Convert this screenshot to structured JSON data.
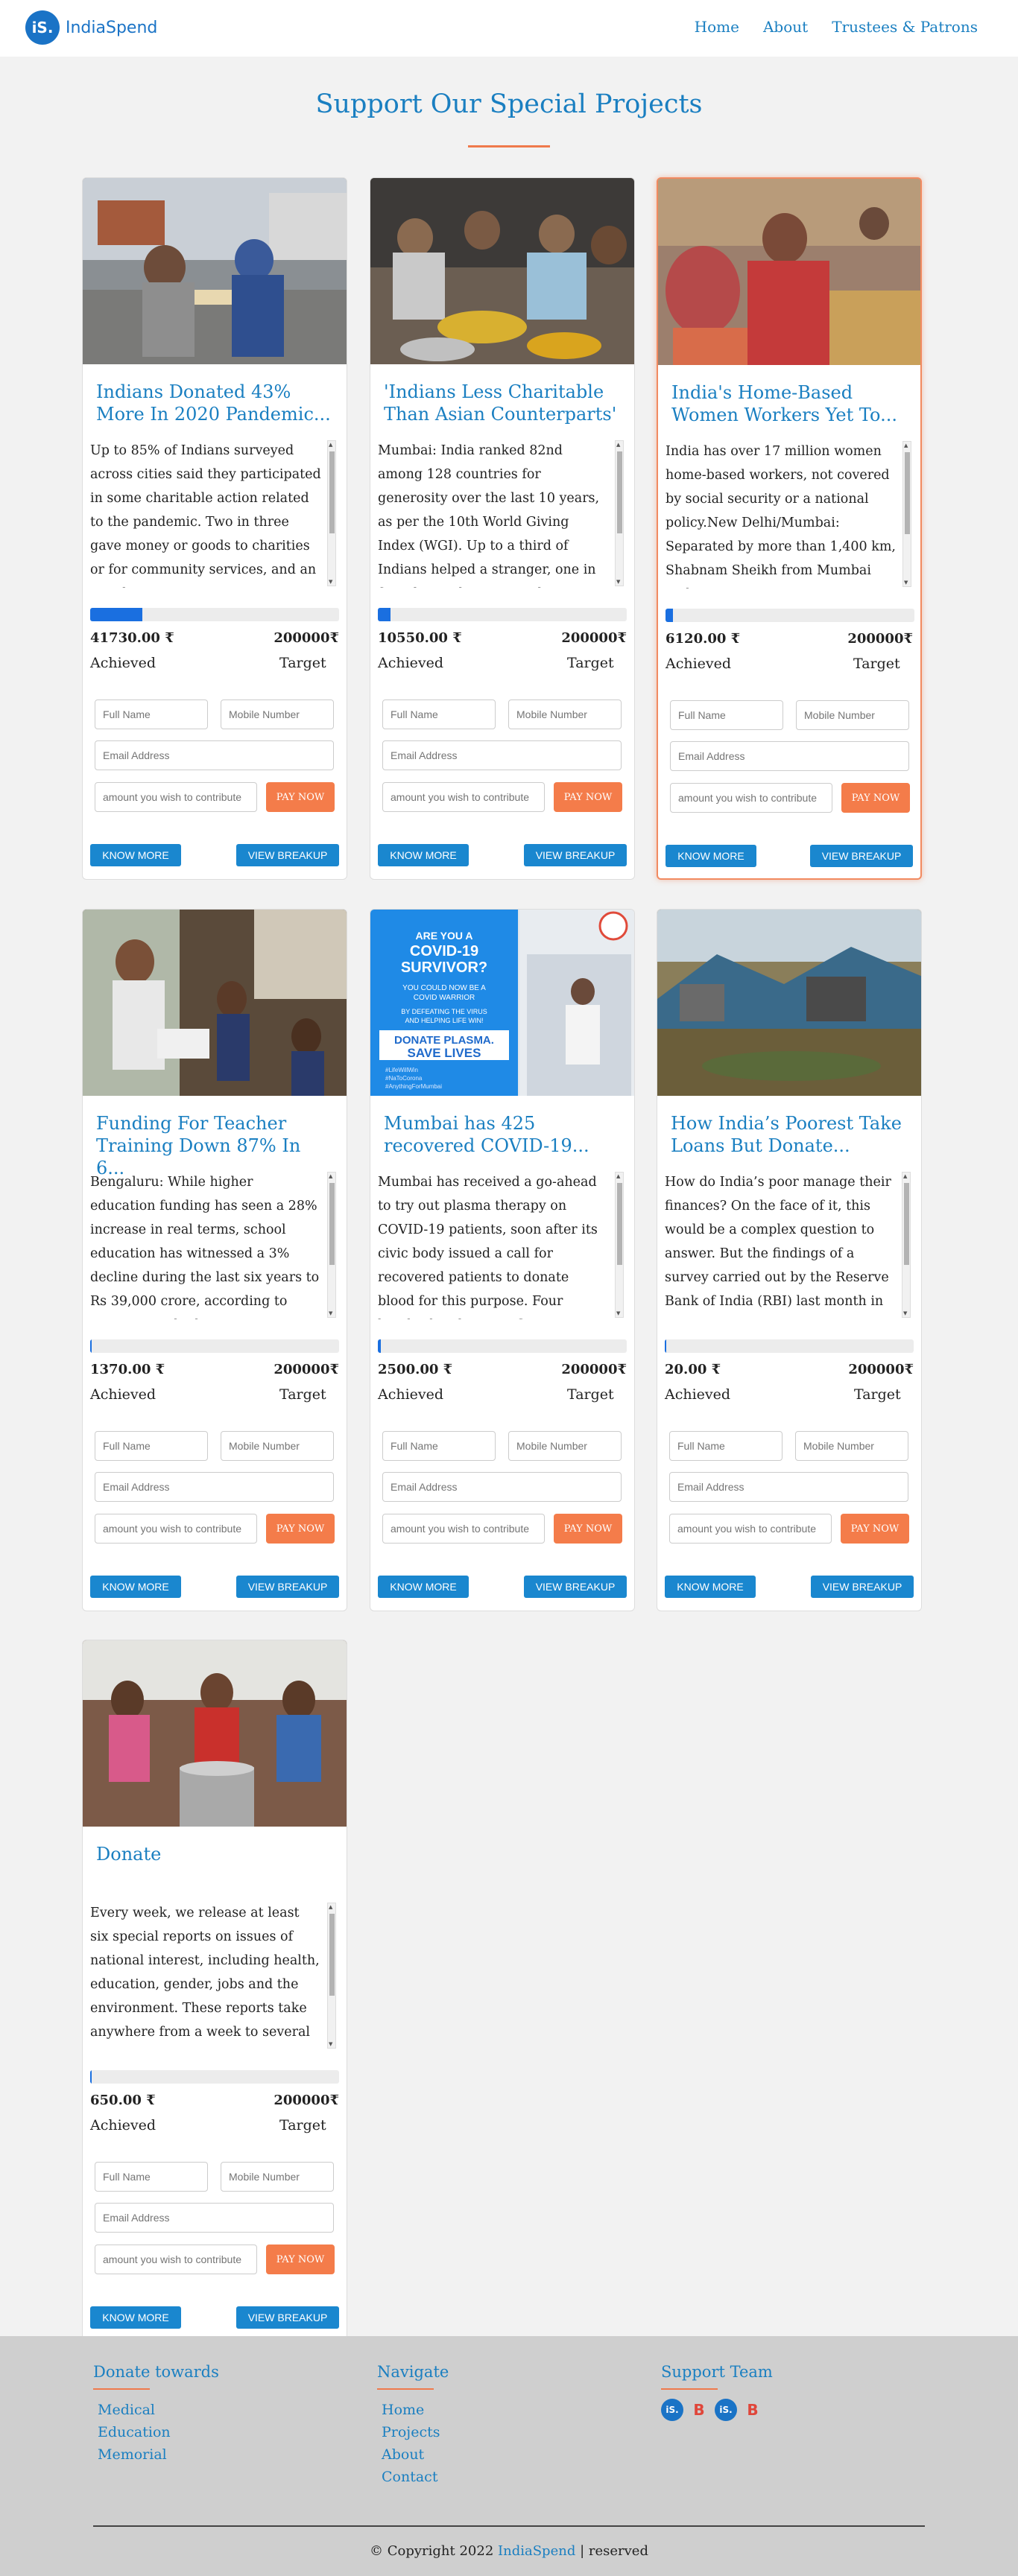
{
  "header": {
    "logo_mark": "iS.",
    "logo_text": "IndiaSpend",
    "nav": [
      "Home",
      "About",
      "Trustees & Patrons"
    ]
  },
  "section_title": "Support Our Special Projects",
  "form": {
    "name_placeholder": "Full Name",
    "mobile_placeholder": "Mobile Number",
    "email_placeholder": "Email Address",
    "amount_placeholder": "amount you wish to contribute",
    "pay_label": "PAY NOW",
    "know_label": "KNOW MORE",
    "breakup_label": "VIEW BREAKUP",
    "achieved_label": "Achieved",
    "target_label": "Target"
  },
  "cards": [
    {
      "title": "Indians Donated 43% More In 2020 Pandemic...",
      "description": "Up to 85% of Indians surveyed across cities said they participated in some charitable action related to the pandemic. Two in three gave money or goods to charities or for community services, and an equal",
      "achieved": "41730.00 ₹",
      "target": "200000₹",
      "progress": 0.21,
      "image": "donation-street"
    },
    {
      "title": "'Indians Less Charitable Than Asian Counterparts'",
      "description": "Mumbai: India ranked 82nd among 128 countries for generosity over the last 10 years, as per the 10th World Giving Index (WGI). Up to a third of Indians helped a stranger, one in four donated money, and",
      "achieved": "10550.00 ₹",
      "target": "200000₹",
      "progress": 0.05,
      "image": "food-serving"
    },
    {
      "title": "India's Home-Based Women Workers Yet To...",
      "description": "India has over 17 million women home-based workers, not covered by social security or a national policy.New Delhi/Mumbai: Separated by more than 1,400 km, Shabnam Sheikh from Mumbai and",
      "achieved": "6120.00 ₹",
      "target": "200000₹",
      "progress": 0.03,
      "image": "women-workers"
    },
    {
      "title": "Funding For Teacher Training Down 87% In 6...",
      "description": "Bengaluru: While higher education funding has seen a 28% increase in real terms, school education has witnessed a 3% decline during the last six years to Rs 39,000 crore, according to government budget",
      "achieved": "1370.00 ₹",
      "target": "200000₹",
      "progress": 0.007,
      "image": "classroom"
    },
    {
      "title": "Mumbai has 425 recovered COVID-19...",
      "description": "Mumbai has received a go-ahead to try out plasma therapy on COVID-19 patients, soon after its civic body issued a call for recovered patients to donate blood for this purpose. Four hundred and twenty-five",
      "achieved": "2500.00 ₹",
      "target": "200000₹",
      "progress": 0.0125,
      "image": "plasma-poster",
      "poster": {
        "line1": "ARE YOU A",
        "line2": "COVID-19",
        "line3": "SURVIVOR?",
        "line4": "YOU COULD NOW BE A",
        "line5": "COVID WARRIOR",
        "line6": "BY DEFEATING THE VIRUS",
        "line7": "AND HELPING LIFE WIN!",
        "line8": "DONATE PLASMA.",
        "line9": "SAVE LIVES",
        "tag1": "#LifeWillWin",
        "tag2": "#NaToCorona",
        "tag3": "#AnythingForMumbai"
      }
    },
    {
      "title": "How India’s Poorest Take Loans But Donate...",
      "description": "How do India’s poor manage their finances? On the face of it, this would be a complex question to answer. But the findings of a survey carried out by the Reserve Bank of India (RBI) last month in",
      "achieved": "20.00 ₹",
      "target": "200000₹",
      "progress": 0.0001,
      "image": "slum"
    },
    {
      "title": "Donate",
      "description": "Every week, we release at least six special reports on issues of national interest, including health, education, gender, jobs and the environment. These reports take anywhere from a week to several",
      "achieved": "650.00 ₹",
      "target": "200000₹",
      "progress": 0.003,
      "image": "children-food"
    }
  ],
  "footer": {
    "col1_title": "Donate towards",
    "col1_links": [
      "Medical",
      "Education",
      "Memorial"
    ],
    "col2_title": "Navigate",
    "col2_links": [
      "Home",
      "Projects",
      "About",
      "Contact"
    ],
    "col3_title": "Support Team",
    "socials": [
      "iS.",
      "B",
      "iS.",
      "B"
    ],
    "copyright_prefix": "© Copyright 2022",
    "copyright_brand": "IndiaSpend",
    "copyright_suffix": "| reserved"
  },
  "colors": {
    "accent": "#1a7fc1",
    "orange": "#f47c4a",
    "progress": "#1a6fe0"
  }
}
